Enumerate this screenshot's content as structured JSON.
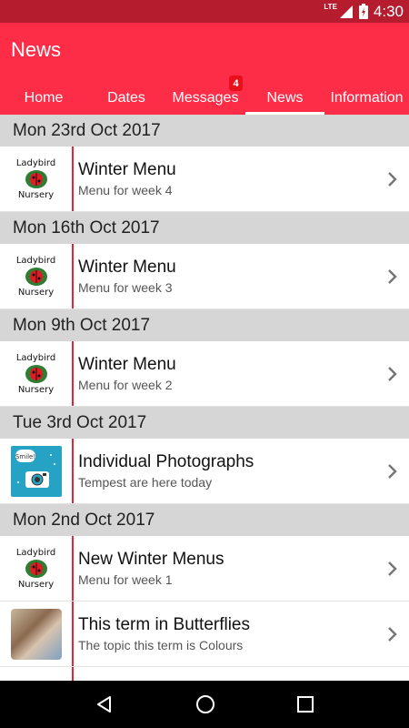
{
  "status": {
    "network": "LTE",
    "time": "4:30"
  },
  "app": {
    "title": "News"
  },
  "tabs": [
    {
      "label": "Home"
    },
    {
      "label": "Dates"
    },
    {
      "label": "Messages",
      "badge": "4"
    },
    {
      "label": "News",
      "active": true
    },
    {
      "label": "Information"
    }
  ],
  "logo": {
    "line1": "Ladybird",
    "line2": "Nursery"
  },
  "sections": [
    {
      "date": "Mon 23rd Oct 2017",
      "items": [
        {
          "title": "Winter Menu",
          "subtitle": "Menu for week 4",
          "thumb": "ladybird-logo"
        }
      ]
    },
    {
      "date": "Mon 16th Oct 2017",
      "items": [
        {
          "title": "Winter Menu",
          "subtitle": "Menu for week 3",
          "thumb": "ladybird-logo"
        }
      ]
    },
    {
      "date": "Mon 9th Oct 2017",
      "items": [
        {
          "title": "Winter Menu",
          "subtitle": "Menu for week 2",
          "thumb": "ladybird-logo"
        }
      ]
    },
    {
      "date": "Tue 3rd Oct 2017",
      "items": [
        {
          "title": "Individual Photographs",
          "subtitle": "Tempest are here today",
          "thumb": "smile-camera",
          "thumb_text": "Smile!"
        }
      ]
    },
    {
      "date": "Mon 2nd Oct 2017",
      "items": [
        {
          "title": "New Winter Menus",
          "subtitle": "Menu for week 1",
          "thumb": "ladybird-logo"
        },
        {
          "title": "This term in Butterflies",
          "subtitle": "The topic this term is Colours",
          "thumb": "children-photo"
        }
      ]
    }
  ],
  "colors": {
    "primary": "#fd2d47",
    "status_bar": "#b51d2f",
    "accent": "#e8243a",
    "header_bg": "#d6d6d6"
  }
}
